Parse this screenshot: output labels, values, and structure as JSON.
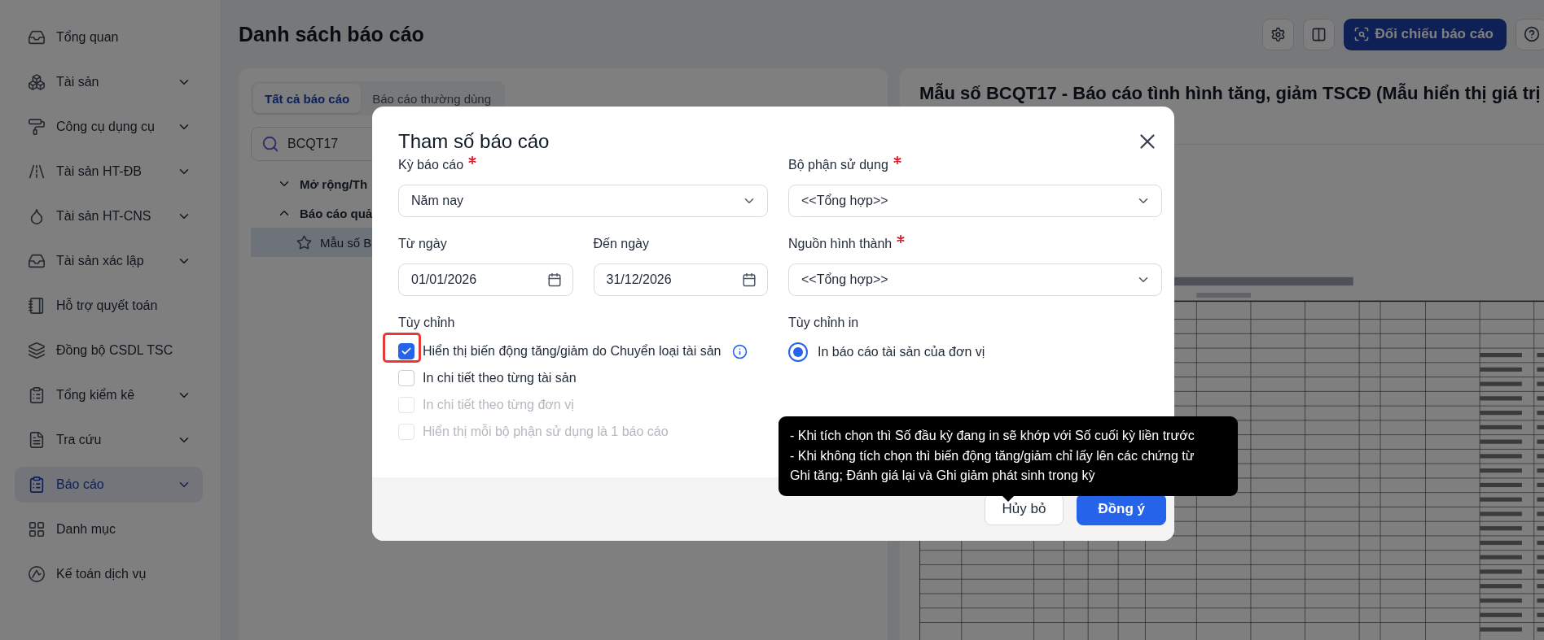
{
  "sidebar": {
    "items": [
      {
        "label": "Tổng quan",
        "expandable": false,
        "selected": false
      },
      {
        "label": "Tài sản",
        "expandable": true,
        "selected": false
      },
      {
        "label": "Công cụ dụng cụ",
        "expandable": true,
        "selected": false
      },
      {
        "label": "Tài sản HT-ĐB",
        "expandable": true,
        "selected": false
      },
      {
        "label": "Tài sản HT-CNS",
        "expandable": true,
        "selected": false
      },
      {
        "label": "Tài sản xác lập",
        "expandable": true,
        "selected": false
      },
      {
        "label": "Hỗ trợ quyết toán",
        "expandable": false,
        "selected": false
      },
      {
        "label": "Đồng bộ CSDL TSC",
        "expandable": false,
        "selected": false
      },
      {
        "label": "Tổng kiểm kê",
        "expandable": true,
        "selected": false
      },
      {
        "label": "Tra cứu",
        "expandable": true,
        "selected": false
      },
      {
        "label": "Báo cáo",
        "expandable": true,
        "selected": true
      },
      {
        "label": "Danh mục",
        "expandable": false,
        "selected": false
      },
      {
        "label": "Kế toán dịch vụ",
        "expandable": false,
        "selected": false
      }
    ]
  },
  "header": {
    "title": "Danh sách báo cáo",
    "compare_button": "Đối chiếu báo cáo"
  },
  "report_list": {
    "tabs": [
      {
        "label": "Tất cả báo cáo",
        "selected": true
      },
      {
        "label": "Báo cáo thường dùng",
        "selected": false
      }
    ],
    "search": {
      "value": "BCQT17"
    },
    "tree": [
      {
        "label": "Mở rộng/Th",
        "expanded": false
      },
      {
        "label": "Báo cáo quả",
        "expanded": true,
        "children": [
          {
            "label": "Mẫu số B",
            "selected": true
          }
        ]
      }
    ]
  },
  "preview": {
    "title": "Mẫu số BCQT17 - Báo cáo tình hình tăng, giảm TSCĐ (Mẫu hiển thị giá trị"
  },
  "dialog": {
    "title": "Tham số báo cáo",
    "period": {
      "label": "Kỳ báo cáo",
      "required": true,
      "value": "Năm nay"
    },
    "from_date": {
      "label": "Từ ngày",
      "value": "01/01/2026"
    },
    "to_date": {
      "label": "Đến ngày",
      "value": "31/12/2026"
    },
    "department": {
      "label": "Bộ phận sử dụng",
      "required": true,
      "value": "<<Tổng hợp>>"
    },
    "source": {
      "label": "Nguồn hình thành",
      "required": true,
      "value": "<<Tổng hợp>>"
    },
    "options": {
      "heading": "Tùy chỉnh",
      "items": [
        {
          "label": "Hiển thị biến động tăng/giảm do Chuyển loại tài sản",
          "checked": true,
          "disabled": false,
          "highlighted": true,
          "info": true
        },
        {
          "label": "In chi tiết theo từng tài sản",
          "checked": false,
          "disabled": false,
          "highlighted": false,
          "info": false
        },
        {
          "label": "In chi tiết theo từng đơn vị",
          "checked": false,
          "disabled": true,
          "highlighted": false,
          "info": false
        },
        {
          "label": "Hiển thị mỗi bộ phận sử dụng là 1 báo cáo",
          "checked": false,
          "disabled": true,
          "highlighted": false,
          "info": false
        }
      ]
    },
    "print_options": {
      "heading": "Tùy chỉnh in",
      "items": [
        {
          "label": "In báo cáo tài sản của đơn vị",
          "selected": true
        }
      ]
    },
    "tooltip": {
      "lines": [
        "- Khi tích chọn thì Số đầu kỳ đang in sẽ khớp với Số cuối kỳ liền trước",
        "- Khi không tích chọn thì biến động tăng/giảm chỉ lấy lên các chứng từ",
        "Ghi tăng; Đánh giá lại và Ghi giảm phát sinh trong kỳ"
      ]
    },
    "buttons": {
      "cancel": "Hủy bỏ",
      "ok": "Đồng ý"
    }
  }
}
